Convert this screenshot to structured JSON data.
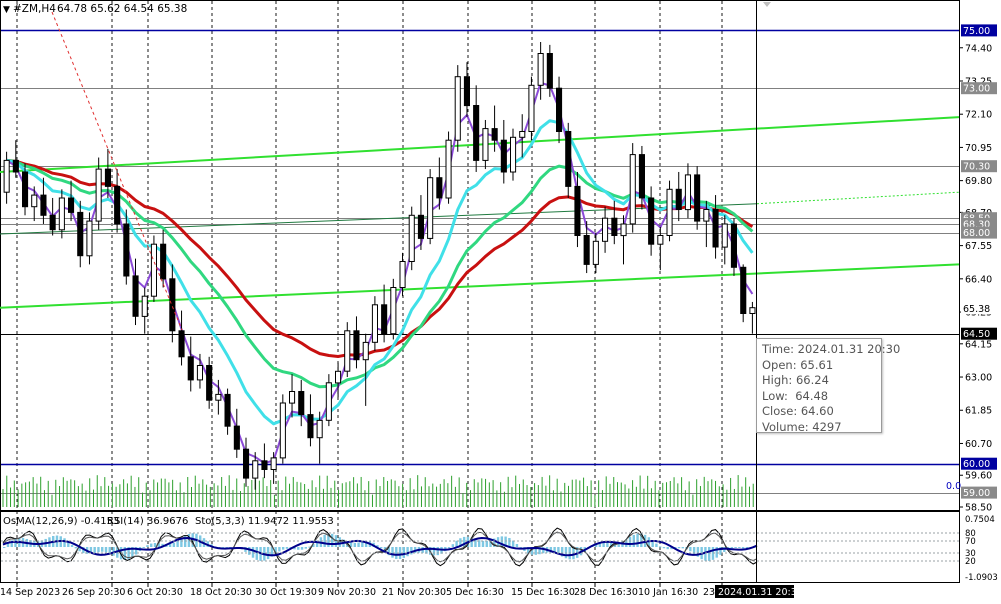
{
  "header": {
    "symbol": "#ZM,H4",
    "ohlc": "64.78 65.62 64.54 65.38"
  },
  "indicator_header": {
    "osma": "OsMA(12,26,9) -0.4153",
    "rsi": "RSI(14) 36.9676",
    "sto": "Sto(5,3,3) 11.9472 11.9553"
  },
  "tooltip": {
    "time": "Time: 2024.01.31 20:30",
    "open": "Open: 65.61",
    "high": "High: 66.24",
    "low": "Low:  64.48",
    "close": "Close: 64.60",
    "volume": "Volume: 4297"
  },
  "chart_data": {
    "type": "candlestick",
    "symbol": "#ZM",
    "timeframe": "H4",
    "ylim": [
      58.5,
      75.5
    ],
    "price_ticks": [
      "74.40",
      "73.25",
      "72.10",
      "70.95",
      "69.80",
      "68.70",
      "67.55",
      "66.40",
      "65.25",
      "64.15",
      "63.00",
      "61.85",
      "60.70",
      "59.60",
      "58.50"
    ],
    "x_tick_labels": [
      "14 Sep 2023",
      "26 Sep 20:30",
      "6 Oct 20:30",
      "18 Oct 20:30",
      "30 Oct 19:30",
      "9 Nov 20:30",
      "21 Nov 20:30",
      "5 Dec 16:30",
      "15 Dec 16:30",
      "28 Dec 16:30",
      "10 Jan 16:30",
      "23"
    ],
    "x_highlight_label": "2024.01.31 20:30",
    "horizontal_levels": [
      {
        "label": "75.00",
        "value": 75.0,
        "color": "#0000a0"
      },
      {
        "label": "73.00",
        "value": 73.0,
        "color": "#808080"
      },
      {
        "label": "70.30",
        "value": 70.3,
        "color": "#808080"
      },
      {
        "label": "68.50",
        "value": 68.5,
        "color": "#808080"
      },
      {
        "label": "68.30",
        "value": 68.3,
        "color": "#808080"
      },
      {
        "label": "68.00",
        "value": 68.0,
        "color": "#808080"
      },
      {
        "label": "64.50",
        "value": 64.5,
        "color": "#000000"
      },
      {
        "label": "60.00",
        "value": 60.0,
        "color": "#0000a0"
      },
      {
        "label": "59.00",
        "value": 59.0,
        "color": "#808080"
      }
    ],
    "current_price": {
      "label": "65.38",
      "value": 65.38
    },
    "volume_zero_label": "0.0",
    "colors": {
      "ema_fast": "#8c4bd8",
      "ema_mid": "#40e0e8",
      "ema_slow": "#30d880",
      "ema_long": "#c81010",
      "channel": "#30e030",
      "levels": "#0000a0"
    },
    "candles": [
      [
        69.4,
        70.8,
        69.0,
        70.5
      ],
      [
        70.5,
        71.2,
        69.9,
        70.1
      ],
      [
        70.1,
        70.4,
        68.6,
        68.9
      ],
      [
        68.9,
        69.6,
        68.4,
        69.3
      ],
      [
        69.3,
        69.9,
        68.3,
        68.6
      ],
      [
        68.6,
        69.2,
        67.9,
        68.1
      ],
      [
        68.1,
        69.5,
        67.8,
        69.2
      ],
      [
        69.2,
        69.8,
        68.4,
        68.7
      ],
      [
        68.7,
        69.1,
        66.8,
        67.2
      ],
      [
        67.2,
        68.7,
        66.9,
        68.4
      ],
      [
        68.4,
        70.6,
        68.1,
        70.2
      ],
      [
        70.2,
        70.9,
        69.2,
        69.6
      ],
      [
        69.6,
        70.2,
        68.0,
        68.3
      ],
      [
        68.3,
        68.8,
        66.2,
        66.5
      ],
      [
        66.5,
        67.1,
        64.8,
        65.1
      ],
      [
        65.1,
        66.1,
        64.5,
        65.8
      ],
      [
        65.8,
        67.9,
        65.6,
        67.6
      ],
      [
        67.6,
        68.1,
        66.1,
        66.4
      ],
      [
        66.4,
        66.9,
        64.2,
        64.6
      ],
      [
        64.6,
        65.3,
        63.4,
        63.7
      ],
      [
        63.7,
        64.4,
        62.5,
        62.9
      ],
      [
        62.9,
        63.8,
        62.6,
        63.4
      ],
      [
        63.4,
        63.7,
        61.9,
        62.2
      ],
      [
        62.2,
        62.9,
        61.7,
        62.4
      ],
      [
        62.4,
        62.6,
        61.0,
        61.3
      ],
      [
        61.3,
        61.9,
        60.2,
        60.5
      ],
      [
        60.5,
        60.9,
        59.2,
        59.5
      ],
      [
        59.5,
        60.4,
        59.1,
        60.1
      ],
      [
        60.1,
        60.7,
        59.5,
        59.8
      ],
      [
        59.8,
        60.4,
        59.3,
        60.2
      ],
      [
        60.2,
        62.4,
        60.0,
        62.1
      ],
      [
        62.1,
        63.1,
        61.6,
        62.5
      ],
      [
        62.5,
        62.9,
        61.3,
        61.7
      ],
      [
        61.7,
        62.4,
        60.6,
        60.9
      ],
      [
        60.9,
        61.8,
        60.0,
        61.5
      ],
      [
        61.5,
        63.1,
        61.3,
        62.8
      ],
      [
        62.8,
        63.5,
        62.3,
        63.2
      ],
      [
        63.2,
        64.9,
        63.0,
        64.6
      ],
      [
        64.6,
        65.1,
        63.3,
        63.6
      ],
      [
        63.6,
        64.5,
        62.0,
        64.2
      ],
      [
        64.2,
        65.8,
        63.9,
        65.5
      ],
      [
        65.5,
        66.2,
        64.2,
        64.5
      ],
      [
        64.5,
        66.4,
        64.3,
        66.1
      ],
      [
        66.1,
        67.3,
        65.8,
        67.0
      ],
      [
        67.0,
        68.9,
        66.7,
        68.6
      ],
      [
        68.6,
        69.3,
        67.4,
        67.8
      ],
      [
        67.8,
        70.2,
        67.6,
        69.9
      ],
      [
        69.9,
        70.6,
        68.8,
        69.2
      ],
      [
        69.2,
        71.5,
        69.0,
        71.2
      ],
      [
        71.2,
        73.8,
        70.8,
        73.4
      ],
      [
        73.4,
        73.9,
        72.0,
        72.4
      ],
      [
        72.4,
        73.1,
        70.1,
        70.5
      ],
      [
        70.5,
        71.9,
        70.2,
        71.6
      ],
      [
        71.6,
        72.4,
        70.8,
        71.2
      ],
      [
        71.2,
        71.9,
        69.7,
        70.1
      ],
      [
        70.1,
        71.6,
        69.8,
        71.3
      ],
      [
        71.3,
        72.1,
        70.6,
        71.5
      ],
      [
        71.5,
        73.4,
        71.2,
        73.1
      ],
      [
        73.1,
        74.6,
        72.6,
        74.2
      ],
      [
        74.2,
        74.5,
        72.7,
        73.0
      ],
      [
        73.0,
        73.4,
        71.1,
        71.5
      ],
      [
        71.5,
        71.8,
        69.2,
        69.6
      ],
      [
        69.6,
        70.1,
        67.5,
        67.9
      ],
      [
        67.9,
        68.4,
        66.6,
        66.9
      ],
      [
        66.9,
        68.0,
        66.6,
        67.7
      ],
      [
        67.7,
        68.9,
        67.3,
        68.5
      ],
      [
        68.5,
        69.1,
        67.6,
        67.9
      ],
      [
        67.9,
        68.6,
        66.9,
        68.3
      ],
      [
        68.3,
        71.1,
        68.0,
        70.7
      ],
      [
        70.7,
        71.0,
        68.8,
        69.2
      ],
      [
        69.2,
        69.6,
        67.2,
        67.6
      ],
      [
        67.6,
        68.2,
        66.7,
        67.9
      ],
      [
        67.9,
        69.8,
        67.7,
        69.5
      ],
      [
        69.5,
        70.1,
        68.4,
        68.8
      ],
      [
        68.8,
        70.4,
        68.5,
        70.0
      ],
      [
        70.0,
        70.3,
        68.1,
        68.4
      ],
      [
        68.4,
        69.1,
        67.5,
        68.8
      ],
      [
        68.8,
        69.3,
        67.1,
        67.5
      ],
      [
        67.5,
        68.6,
        66.9,
        68.3
      ],
      [
        68.3,
        68.5,
        66.5,
        66.8
      ],
      [
        66.8,
        66.9,
        64.9,
        65.2
      ],
      [
        65.2,
        65.6,
        64.5,
        65.4
      ]
    ]
  }
}
